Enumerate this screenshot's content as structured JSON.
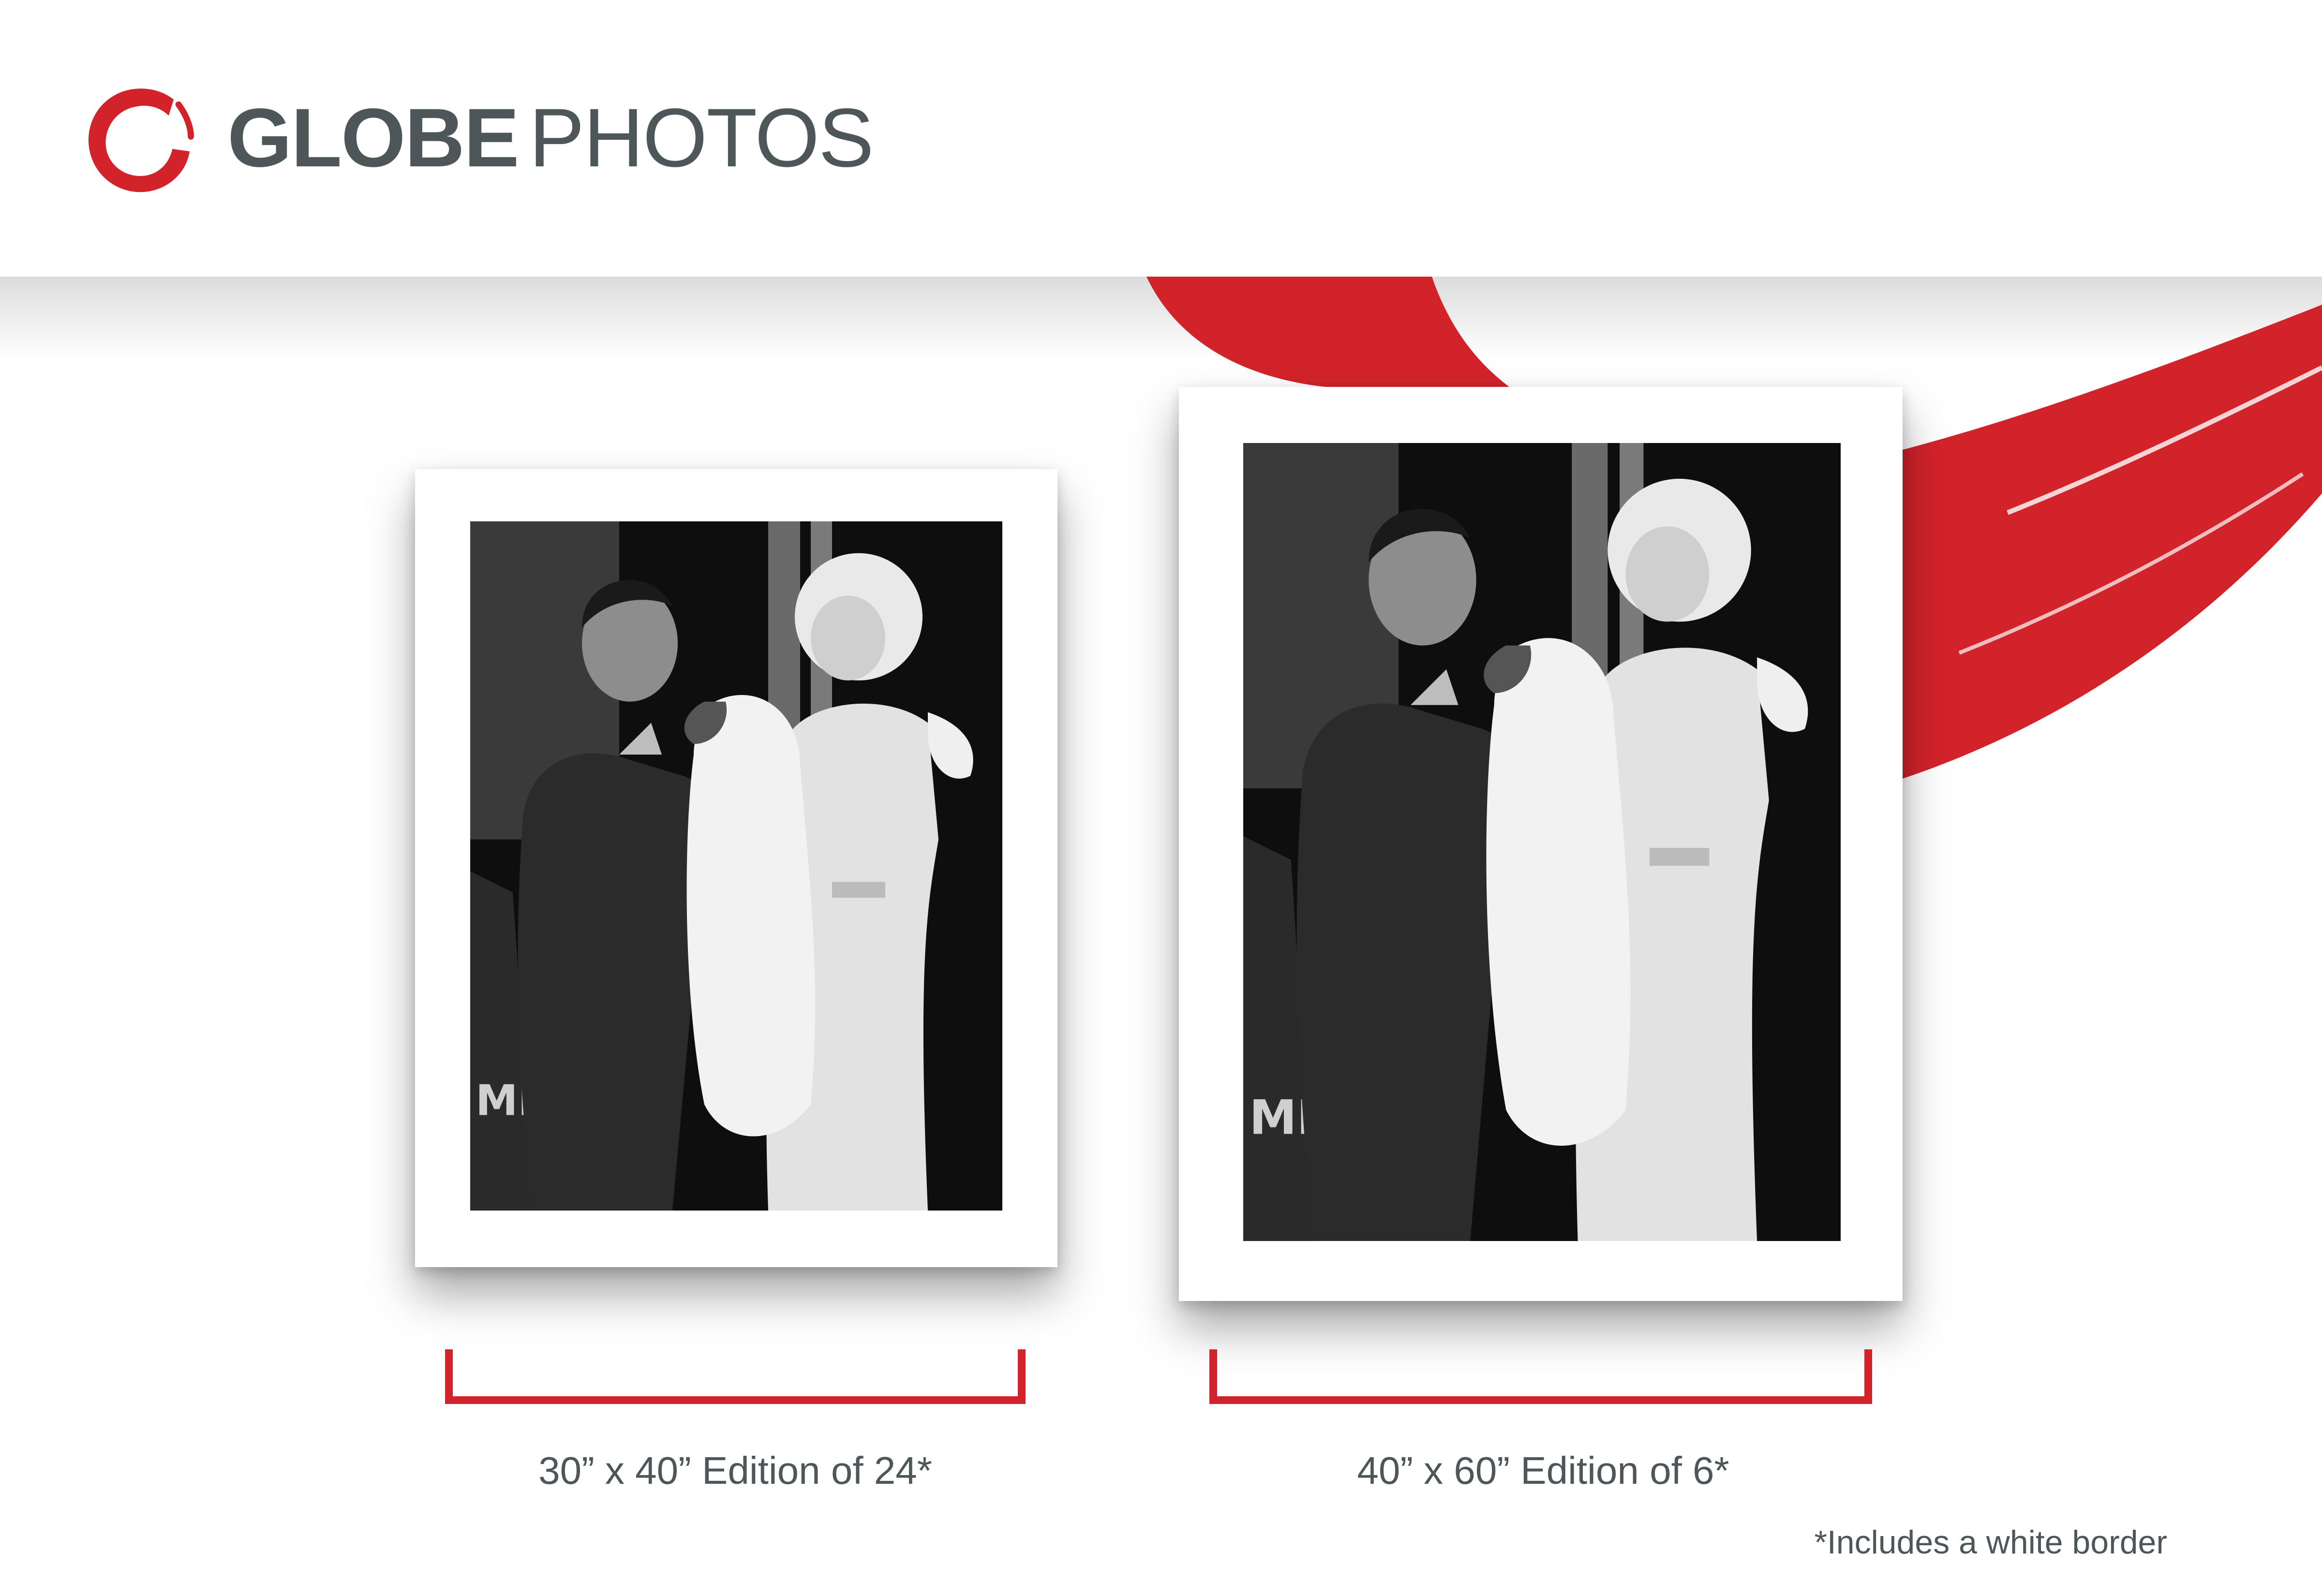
{
  "brand": {
    "name_bold": "GLOBE",
    "name_light": "PHOTOS",
    "logo_icon": "red-brush-circle-logo",
    "accent_color": "#d2232a",
    "text_color": "#4d5659"
  },
  "prints": [
    {
      "caption": "30” x 40” Edition of 24*",
      "photo_alt": "Black and white photograph of a man placing a white fur stole on a woman in a strapless satin gown",
      "bracket_color": "#d2232a"
    },
    {
      "caption": "40” x 60” Edition of 6*",
      "photo_alt": "Black and white photograph of a man placing a white fur stole on a woman in a strapless satin gown",
      "bracket_color": "#d2232a"
    }
  ],
  "footnote": "*Includes a white border"
}
